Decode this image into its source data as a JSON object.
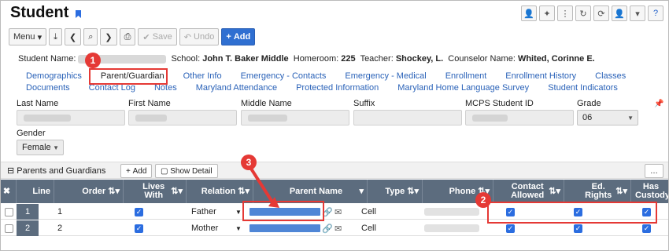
{
  "header": {
    "title": "Student"
  },
  "toolbar": {
    "menu": "Menu",
    "save": "Save",
    "undo": "Undo",
    "add": "Add"
  },
  "info": {
    "student_name_label": "Student Name:",
    "school_label": "School:",
    "school": "John T. Baker Middle",
    "homeroom_label": "Homeroom:",
    "homeroom": "225",
    "teacher_label": "Teacher:",
    "teacher": "Shockey, L.",
    "counselor_label": "Counselor Name:",
    "counselor": "Whited, Corinne E."
  },
  "tabs_row1": [
    "Demographics",
    "Parent/Guardian",
    "Other Info",
    "Emergency - Contacts",
    "Emergency - Medical",
    "Enrollment",
    "Enrollment History",
    "Classes"
  ],
  "tabs_row2": [
    "Documents",
    "Contact Log",
    "Notes",
    "Maryland Attendance",
    "Protected Information",
    "Maryland Home Language Survey",
    "Student Indicators"
  ],
  "form": {
    "last_name": "Last Name",
    "first_name": "First Name",
    "middle_name": "Middle Name",
    "suffix": "Suffix",
    "mcps_id": "MCPS Student ID",
    "grade": "Grade",
    "grade_value": "06",
    "gender": "Gender",
    "gender_value": "Female"
  },
  "grid": {
    "title": "Parents and Guardians",
    "add": "Add",
    "show_detail": "Show Detail",
    "columns": [
      "Line",
      "Order",
      "Lives With",
      "Relation",
      "Parent Name",
      "Type",
      "Phone",
      "Contact Allowed",
      "Ed. Rights",
      "Has Custody"
    ],
    "rows": [
      {
        "line": "1",
        "order": "1",
        "relation": "Father",
        "type": "Cell"
      },
      {
        "line": "2",
        "order": "2",
        "relation": "Mother",
        "type": "Cell"
      }
    ]
  },
  "annotations": [
    "1",
    "2",
    "3"
  ],
  "colors": {
    "accent": "#2f6fd1",
    "annotation": "#e53935",
    "grid_header": "#5c6c7e"
  }
}
